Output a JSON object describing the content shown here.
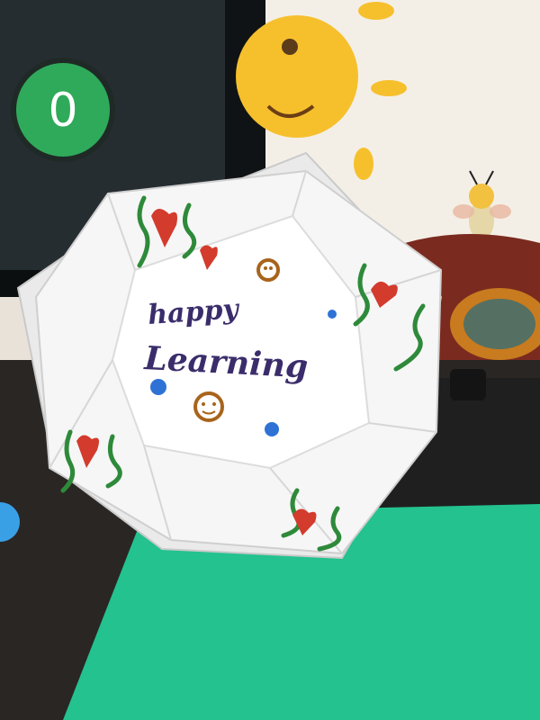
{
  "monitor": {
    "counter_value": "0"
  },
  "card": {
    "line1": "happy",
    "line2": "Learning"
  },
  "colors": {
    "wall": "#f4efe6",
    "monitor": "#1b2024",
    "counter_badge": "#2faa5a",
    "sun": "#f6c02d",
    "desk": "#2a2624",
    "mat": "#23c28f",
    "paper": "#f6f6f6",
    "ink_purple": "#3b2d6b",
    "ink_green": "#2e8a3a",
    "ink_red": "#d33b2d",
    "ink_blue": "#2f72d6",
    "ink_brown": "#a8641c"
  }
}
